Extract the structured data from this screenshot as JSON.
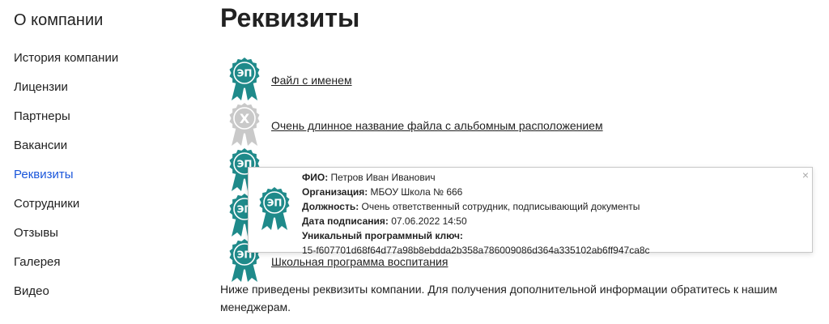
{
  "sidebar": {
    "title": "О компании",
    "items": [
      {
        "label": "История компании",
        "active": false
      },
      {
        "label": "Лицензии",
        "active": false
      },
      {
        "label": "Партнеры",
        "active": false
      },
      {
        "label": "Вакансии",
        "active": false
      },
      {
        "label": "Реквизиты",
        "active": true
      },
      {
        "label": "Сотрудники",
        "active": false
      },
      {
        "label": "Отзывы",
        "active": false
      },
      {
        "label": "Галерея",
        "active": false
      },
      {
        "label": "Видео",
        "active": false
      }
    ]
  },
  "page": {
    "title": "Реквизиты",
    "description": "Ниже приведены реквизиты компании. Для получения дополнительной информации обратитесь к нашим менеджерам."
  },
  "files": [
    {
      "name": "Файл с именем",
      "badge": "ЭП",
      "valid": true
    },
    {
      "name": "Очень длинное название файла с альбомным расположением",
      "badge": "X",
      "valid": false
    },
    {
      "name": "",
      "badge": "ЭП",
      "valid": true
    },
    {
      "name": "",
      "badge": "ЭП",
      "valid": true
    },
    {
      "name": "Школьная программа воспитания",
      "badge": "ЭП",
      "valid": true
    }
  ],
  "popup": {
    "badge": "ЭП",
    "close": "×",
    "fio_label": "ФИО:",
    "fio": "Петров Иван Иванович",
    "org_label": "Организация:",
    "org": "МБОУ Школа № 666",
    "position_label": "Должность:",
    "position": "Очень ответственный сотрудник, подписывающий документы",
    "date_label": "Дата подписания:",
    "date": "07.06.2022 14:50",
    "key_label": "Уникальный программный ключ:",
    "key": "15-f607701d68f64d77a98b8ebdda2b358a786009086d364a335102ab6ff947ca8c"
  },
  "colors": {
    "accent": "#1a56db",
    "badge_valid": "#1f8a8a",
    "badge_invalid": "#c9c9c9"
  }
}
